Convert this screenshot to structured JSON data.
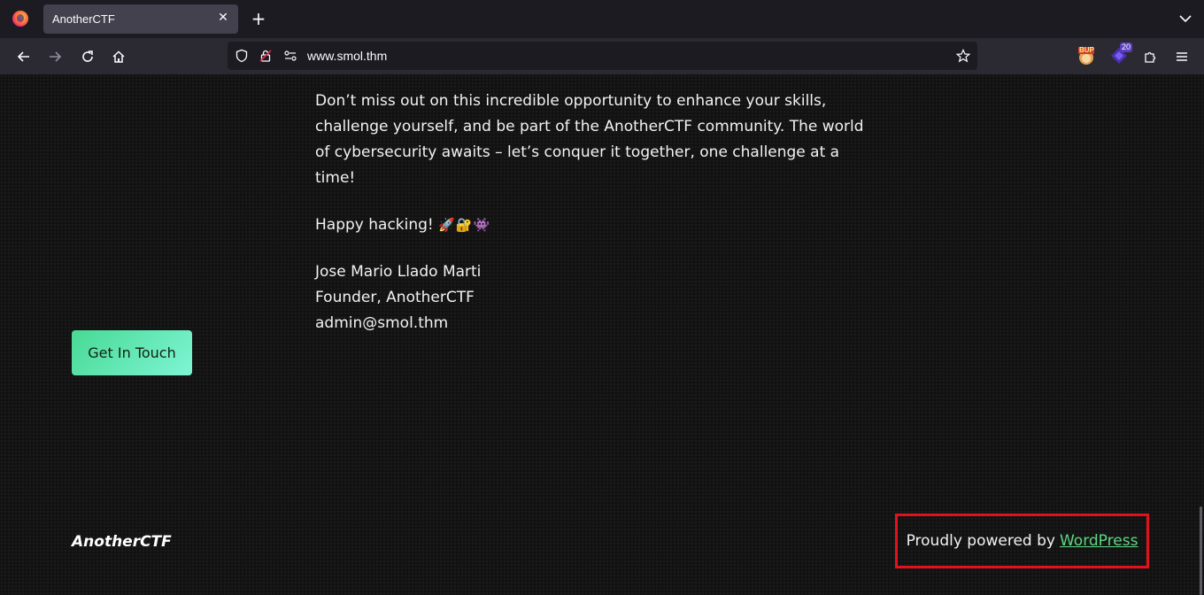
{
  "browser": {
    "tab_title": "AnotherCTF",
    "url": "www.smol.thm",
    "extensions": [
      {
        "name": "burp-extension",
        "label": "BUP"
      },
      {
        "name": "shield-extension",
        "badge": "20"
      }
    ]
  },
  "page": {
    "paragraphs": [
      "Don’t miss out on this incredible opportunity to enhance your skills, challenge yourself, and be part of the AnotherCTF community. The world of cybersecurity awaits – let’s conquer it together, one challenge at a time!",
      "Happy hacking!"
    ],
    "happy_emoji": "🚀🔐👾",
    "signature": {
      "name": "Jose Mario Llado Marti",
      "role": "Founder, AnotherCTF",
      "email": "admin@smol.thm"
    },
    "cta_label": "Get In Touch",
    "footer": {
      "brand": "AnotherCTF",
      "credit_prefix": "Proudly powered by",
      "credit_link": "WordPress"
    }
  },
  "colors": {
    "page_bg": "#121212",
    "accent": "#5fd785",
    "highlight_border": "#e3111b"
  }
}
